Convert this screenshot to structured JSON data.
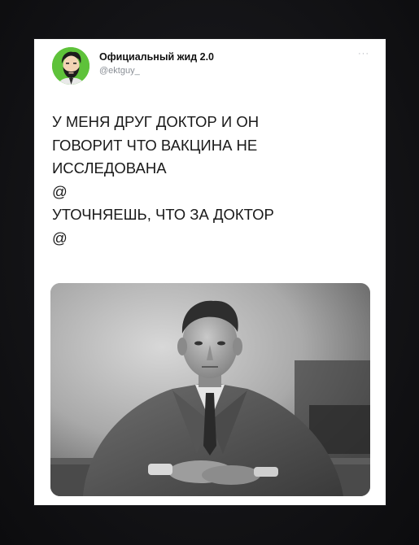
{
  "tweet": {
    "author_name": "Официальный жид 2.0",
    "author_handle": "@ektguy_",
    "more_label": "···",
    "lines": [
      "У МЕНЯ ДРУГ ДОКТОР И ОН",
      "ГОВОРИТ ЧТО ВАКЦИНА НЕ",
      "ИССЛЕДОВАНА",
      "@",
      "УТОЧНЯЕШЬ, ЧТО ЗА ДОКТОР",
      "@"
    ]
  },
  "icons": {
    "avatar": "cartoon-bearded-man-avatar",
    "more": "more-options-icon"
  },
  "colors": {
    "background": "#141417",
    "card": "#ffffff",
    "avatar_bg": "#5ec23a",
    "handle": "#8a8f96"
  }
}
